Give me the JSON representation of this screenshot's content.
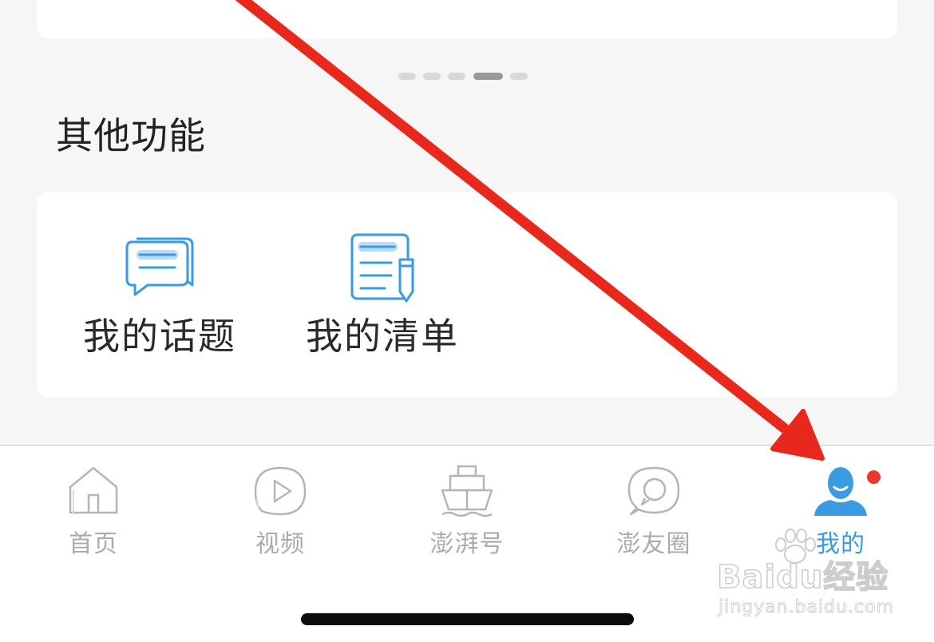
{
  "section": {
    "title": "其他功能"
  },
  "pager": {
    "count": 5,
    "active_index": 3
  },
  "functions": [
    {
      "label": "我的话题",
      "icon": "chat-bubble-icon"
    },
    {
      "label": "我的清单",
      "icon": "list-edit-icon"
    }
  ],
  "tabbar": {
    "items": [
      {
        "label": "首页",
        "icon": "home-icon",
        "active": false
      },
      {
        "label": "视频",
        "icon": "play-icon",
        "active": false
      },
      {
        "label": "澎湃号",
        "icon": "ship-icon",
        "active": false
      },
      {
        "label": "澎友圈",
        "icon": "chat-circle-icon",
        "active": false
      },
      {
        "label": "我的",
        "icon": "user-icon",
        "active": true,
        "badge": "red-dot"
      }
    ]
  },
  "watermark": {
    "brand": "Baidu经验",
    "url": "jingyan.baidu.com"
  },
  "colors": {
    "accent": "#3a9be0",
    "inactive": "#a9abad",
    "annotation_arrow": "#e8281c",
    "badge": "#e8392f",
    "background": "#f6f6f7"
  }
}
